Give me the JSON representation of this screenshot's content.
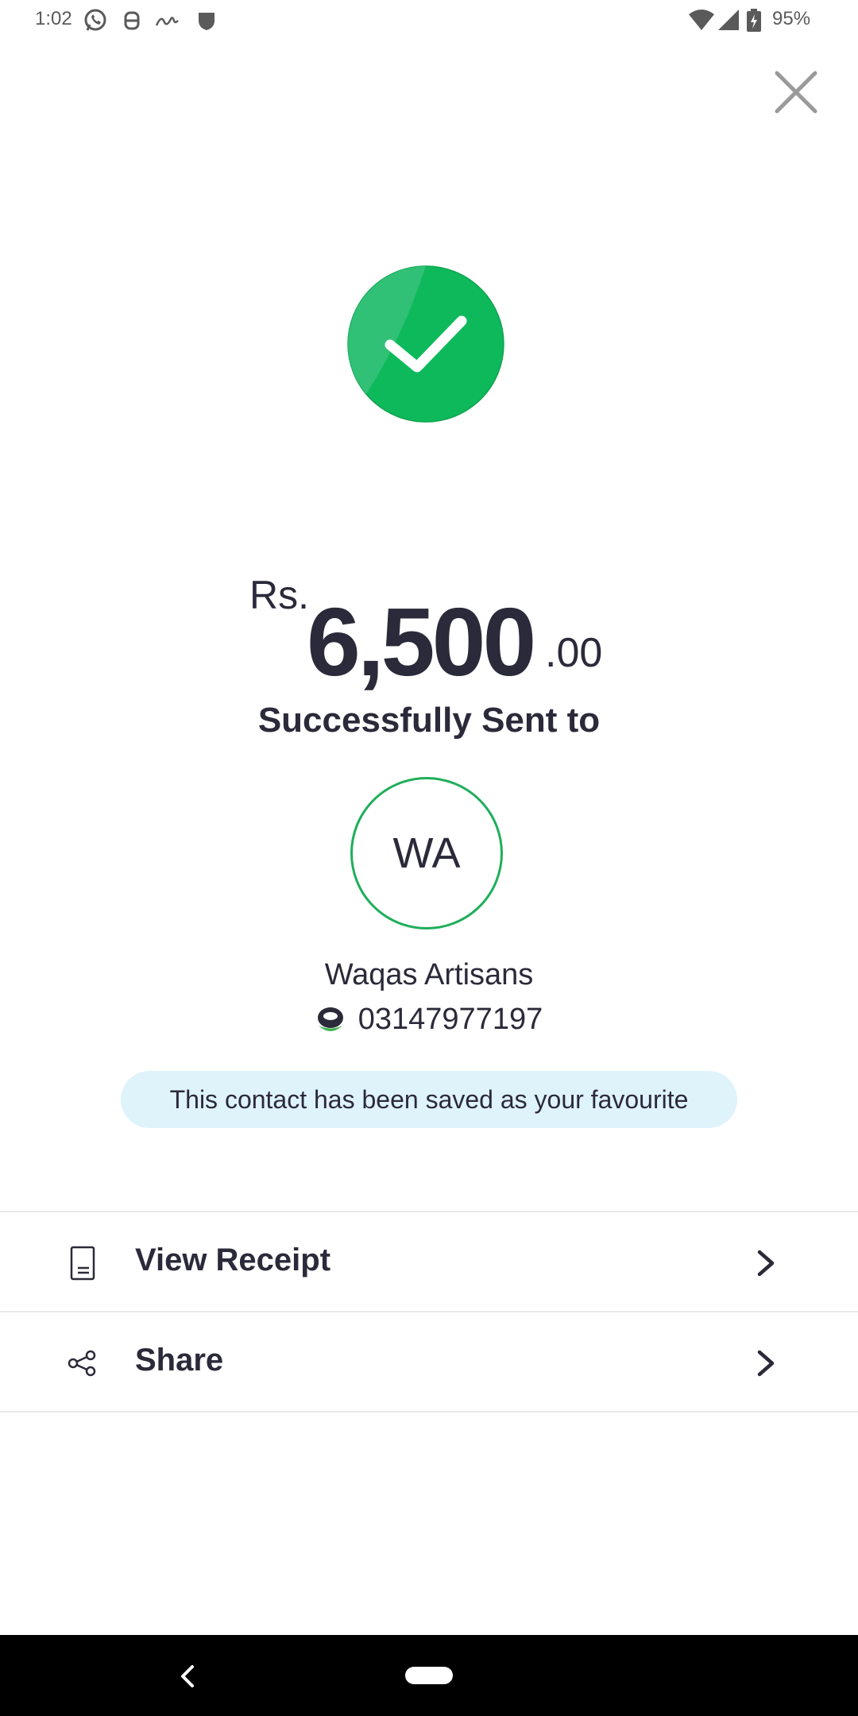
{
  "status_bar": {
    "time": "1:02",
    "battery": "95%",
    "icons": [
      "whatsapp-icon",
      "bot-icon",
      "signature-icon",
      "shield-icon",
      "wifi-icon",
      "cellular-icon",
      "battery-charging-icon"
    ]
  },
  "header": {
    "close_icon": "close-icon"
  },
  "success": {
    "icon": "checkmark-circle-icon",
    "color": "#17b65a"
  },
  "amount": {
    "currency": "Rs.",
    "whole": "6,500",
    "decimal": ".00"
  },
  "status_message": "Successfully Sent to",
  "recipient": {
    "initials": "WA",
    "name": "Waqas Artisans",
    "number": "03147977197",
    "wallet_icon": "easypaisa-icon"
  },
  "favourite_banner": "This contact has been saved as your favourite",
  "actions": [
    {
      "label": "View Receipt",
      "icon": "receipt-icon"
    },
    {
      "label": "Share",
      "icon": "share-icon"
    }
  ],
  "colors": {
    "accent_green": "#1fae5a",
    "banner_bg": "#dff3fb",
    "text_primary": "#2b2a3a"
  }
}
